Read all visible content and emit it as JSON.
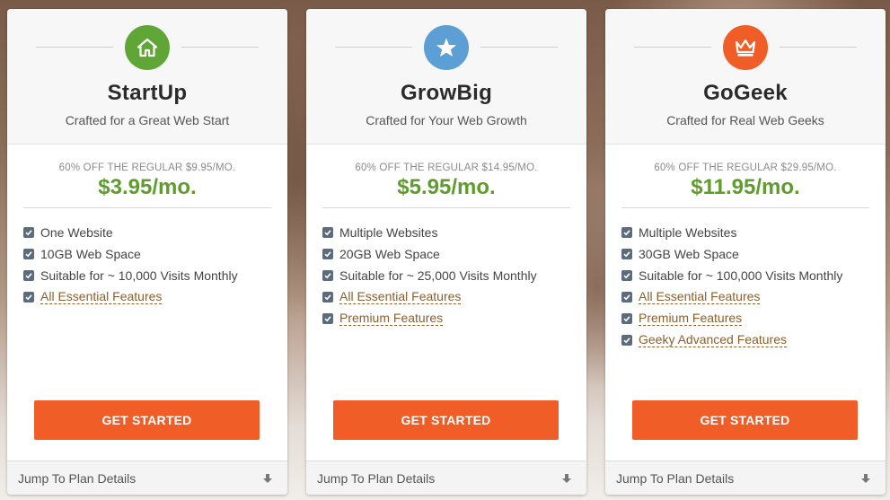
{
  "colors": {
    "price_green": "#5e9c2b",
    "cta_orange": "#f15d27",
    "startup_badge": "#5fa637",
    "growbig_badge": "#5b9fd5",
    "gogeek_badge": "#f15d27",
    "checkbox": "#5c6c7c"
  },
  "plans": [
    {
      "name": "StartUp",
      "tagline": "Crafted for a Great Web Start",
      "icon": "house-icon",
      "regular": "60% OFF THE REGULAR $9.95/MO.",
      "price": "$3.95/mo.",
      "features": [
        {
          "label": "One Website",
          "link": false
        },
        {
          "label": "10GB Web Space",
          "link": false
        },
        {
          "label": "Suitable for ~ 10,000 Visits Monthly",
          "link": false
        },
        {
          "label": "All Essential Features",
          "link": true
        }
      ],
      "cta": "GET STARTED",
      "footer": "Jump To Plan Details"
    },
    {
      "name": "GrowBig",
      "tagline": "Crafted for Your Web Growth",
      "icon": "star-icon",
      "regular": "60% OFF THE REGULAR $14.95/MO.",
      "price": "$5.95/mo.",
      "features": [
        {
          "label": "Multiple Websites",
          "link": false
        },
        {
          "label": "20GB Web Space",
          "link": false
        },
        {
          "label": "Suitable for ~ 25,000 Visits Monthly",
          "link": false
        },
        {
          "label": "All Essential Features",
          "link": true
        },
        {
          "label": "Premium Features",
          "link": true
        }
      ],
      "cta": "GET STARTED",
      "footer": "Jump To Plan Details"
    },
    {
      "name": "GoGeek",
      "tagline": "Crafted for Real Web Geeks",
      "icon": "crown-icon",
      "regular": "60% OFF THE REGULAR $29.95/MO.",
      "price": "$11.95/mo.",
      "features": [
        {
          "label": "Multiple Websites",
          "link": false
        },
        {
          "label": "30GB Web Space",
          "link": false
        },
        {
          "label": "Suitable for ~ 100,000 Visits Monthly",
          "link": false
        },
        {
          "label": "All Essential Features",
          "link": true
        },
        {
          "label": "Premium Features",
          "link": true
        },
        {
          "label": "Geeky Advanced Features",
          "link": true
        }
      ],
      "cta": "GET STARTED",
      "footer": "Jump To Plan Details"
    }
  ]
}
